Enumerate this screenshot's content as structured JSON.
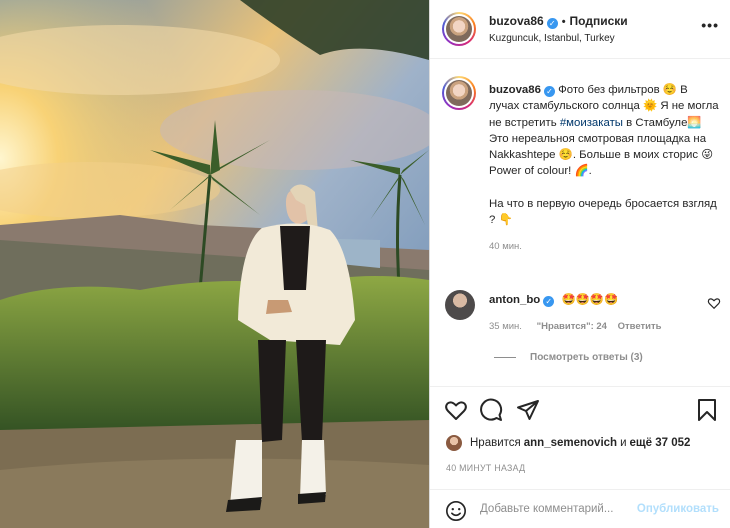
{
  "post": {
    "username": "buzova86",
    "follow_label": "Подписки",
    "location": "Kuzguncuk, Istanbul, Turkey",
    "more_label": "•••",
    "verified_mark": "✓"
  },
  "caption": {
    "username": "buzova86",
    "text_1": "Фото без фильтров ☺️ В лучах стамбульского солнца ",
    "emoji_sun": "🌞",
    "text_2": " Я не могла не встретить ",
    "hashtag": "#моизакаты",
    "text_3": " в Стамбуле",
    "emoji_sunset": "🌅",
    "text_4": " Это нереальноя смотровая площадка на Nakkashtepe ☺️. Больше в моих сторис ",
    "emoji_wink": "😜",
    "text_5": "Power of colour! ",
    "emoji_rainbow": "🌈",
    "text_6": ".",
    "text_7": "На что в первую очередь бросается взгляд ? ",
    "emoji_point": "👇",
    "age": "40 мин."
  },
  "comment": {
    "username": "anton_bo",
    "text": "🤩🤩🤩🤩",
    "age": "35 мин.",
    "likes_label": "\"Нравится\": 24",
    "reply_label": "Ответить",
    "view_replies": "Посмотреть ответы (3)"
  },
  "likes": {
    "prefix": "Нравится ",
    "user": "ann_semenovich",
    "middle": " и ",
    "others": "ещё 37 052"
  },
  "timestamp": "40 МИНУТ НАЗАД",
  "add_comment": {
    "placeholder": "Добавьте комментарий...",
    "publish_label": "Опубликовать"
  },
  "colors": {
    "verified": "#3897f0",
    "hashtag": "#00376b",
    "muted": "#8e8e8e",
    "publish_disabled": "#b2dffc"
  }
}
